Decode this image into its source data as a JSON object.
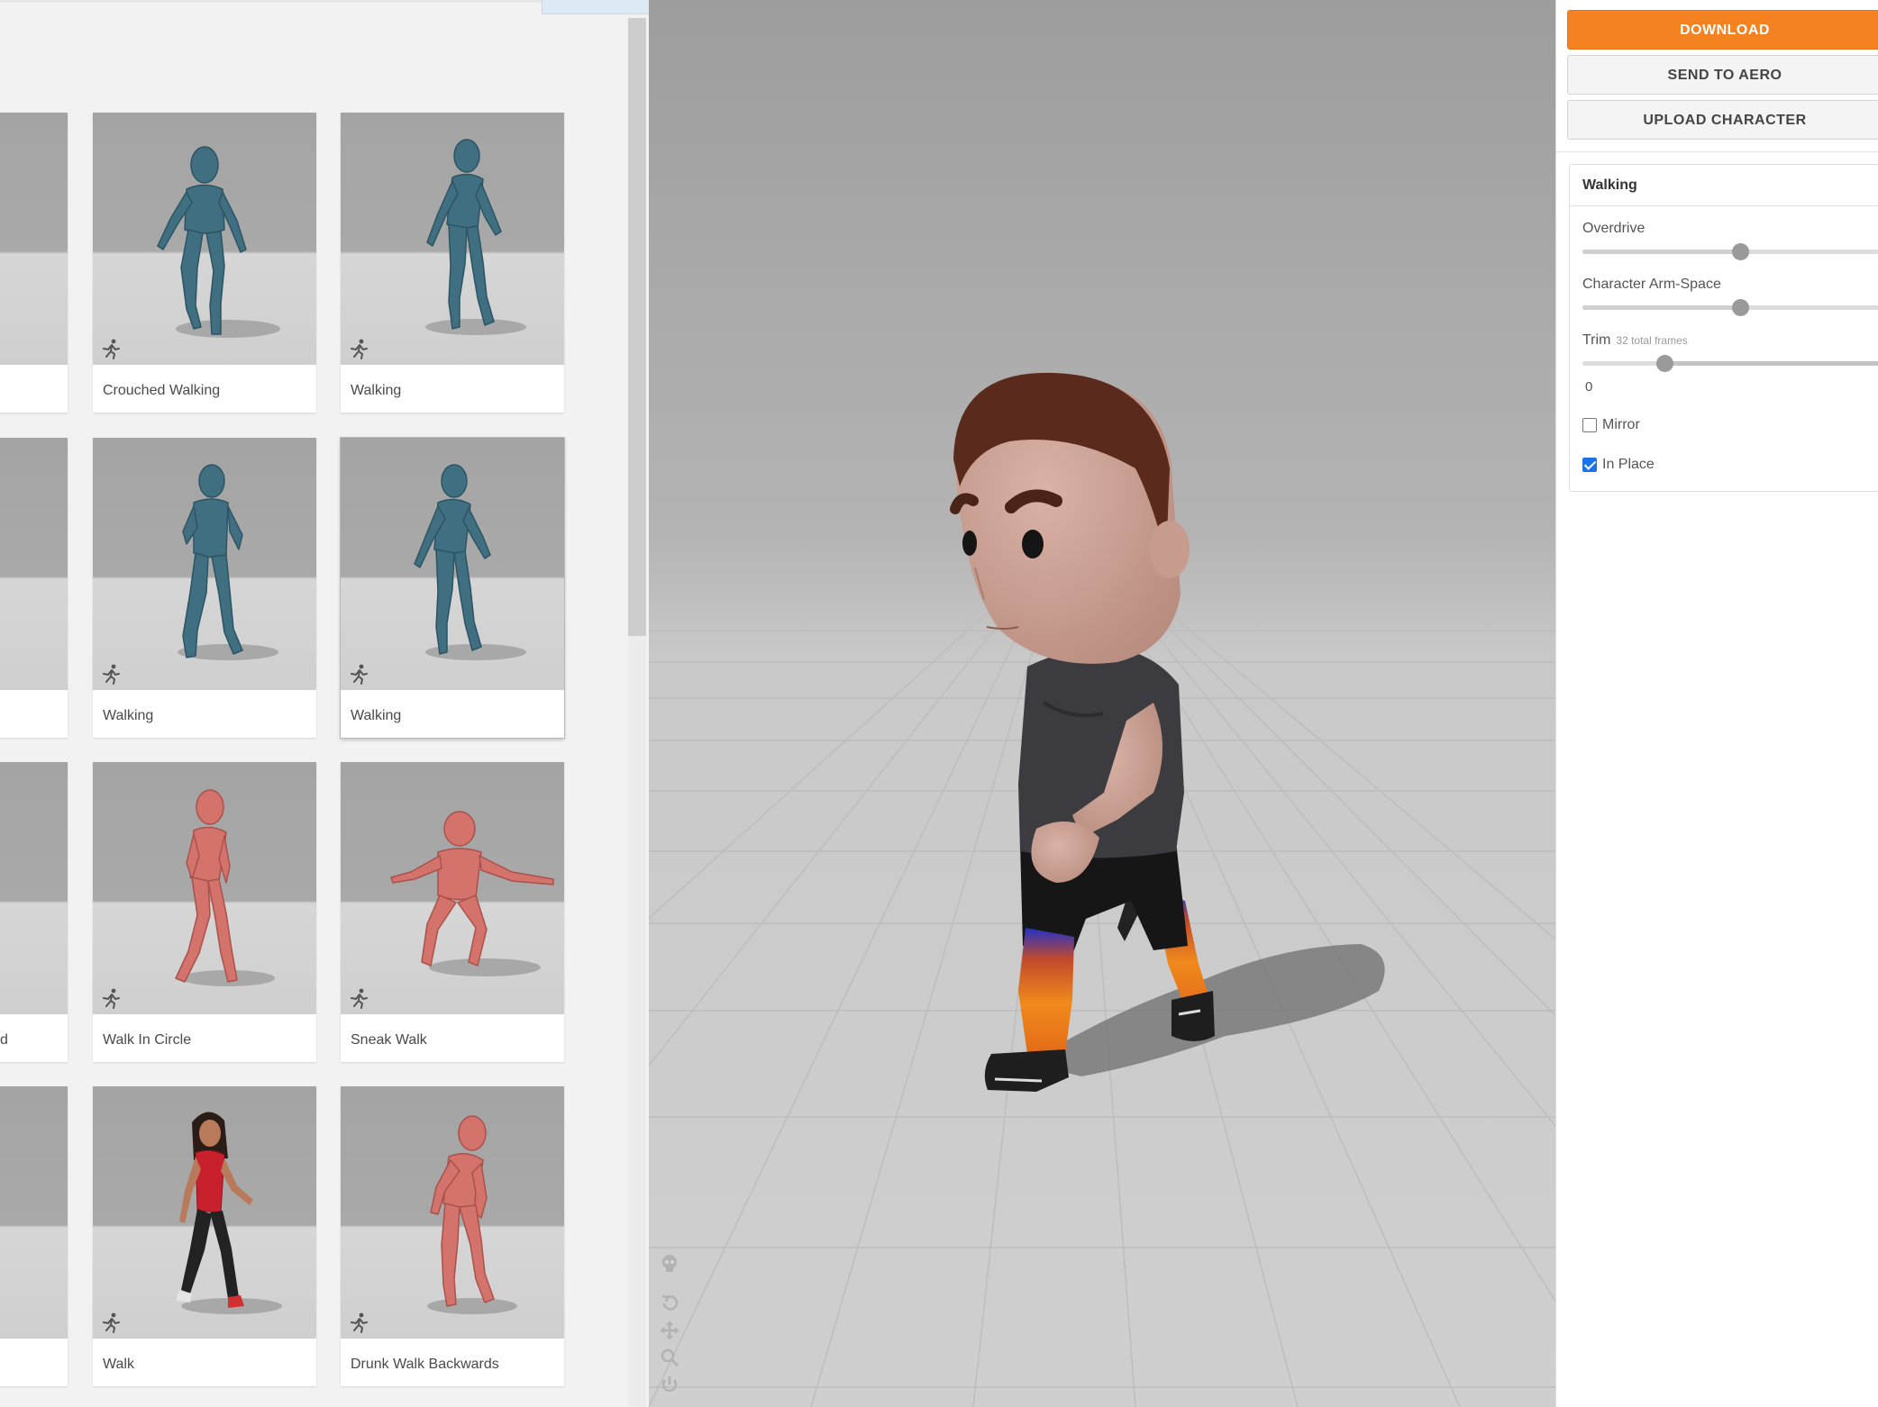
{
  "library": {
    "cards": [
      {
        "label": "",
        "figure": "blue"
      },
      {
        "label": "Crouched Walking",
        "figure": "blue"
      },
      {
        "label": "Walking",
        "figure": "blue"
      },
      {
        "label": "",
        "figure": "blue"
      },
      {
        "label": "Walking",
        "figure": "blue"
      },
      {
        "label": "Walking",
        "figure": "blue",
        "selected": true
      },
      {
        "label": "d",
        "figure": "blue"
      },
      {
        "label": "Walk In Circle",
        "figure": "red"
      },
      {
        "label": "Sneak Walk",
        "figure": "red"
      },
      {
        "label": "",
        "figure": "blue"
      },
      {
        "label": "Walk",
        "figure": "woman"
      },
      {
        "label": "Drunk Walk Backwards",
        "figure": "red"
      }
    ]
  },
  "viewport": {
    "tools": [
      "skull-icon",
      "undo-icon",
      "move-icon",
      "zoom-icon",
      "power-icon"
    ]
  },
  "panel": {
    "download_label": "DOWNLOAD",
    "send_label": "SEND TO AERO",
    "upload_label": "UPLOAD CHARACTER",
    "settings": {
      "title": "Walking",
      "overdrive": {
        "label": "Overdrive",
        "value": 0.5
      },
      "arm_space": {
        "label": "Character Arm-Space",
        "value": 0.5
      },
      "trim": {
        "label": "Trim",
        "note": "32 total frames",
        "start": 0.26,
        "end": 1.0,
        "value_text": "0"
      },
      "mirror": {
        "label": "Mirror",
        "checked": false
      },
      "in_place": {
        "label": "In Place",
        "checked": true
      }
    }
  },
  "colors": {
    "accent": "#f58220",
    "checkbox": "#1a73e8",
    "mannequin_blue": "#3f6f80",
    "mannequin_red": "#d4736b"
  }
}
